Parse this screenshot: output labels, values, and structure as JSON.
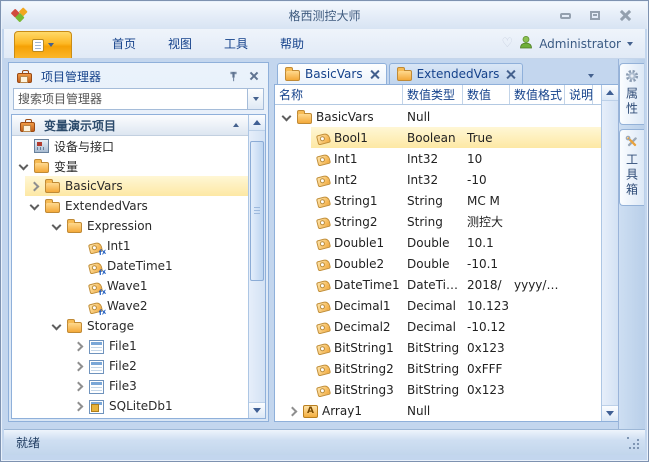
{
  "window": {
    "title": "格西测控大师"
  },
  "ribbon": {
    "tabs": {
      "home": "首页",
      "view": "视图",
      "tools": "工具",
      "help": "帮助"
    },
    "user": "Administrator"
  },
  "project_panel": {
    "title": "项目管理器",
    "search_placeholder": "搜索项目管理器",
    "root": "变量演示项目",
    "items": [
      {
        "label": "设备与接口"
      },
      {
        "label": "变量"
      },
      {
        "label": "BasicVars"
      },
      {
        "label": "ExtendedVars"
      },
      {
        "label": "Expression"
      },
      {
        "label": "Int1"
      },
      {
        "label": "DateTime1"
      },
      {
        "label": "Wave1"
      },
      {
        "label": "Wave2"
      },
      {
        "label": "Storage"
      },
      {
        "label": "File1"
      },
      {
        "label": "File2"
      },
      {
        "label": "File3"
      },
      {
        "label": "SQLiteDb1"
      }
    ]
  },
  "document": {
    "tabs": [
      {
        "label": "BasicVars"
      },
      {
        "label": "ExtendedVars"
      }
    ]
  },
  "grid": {
    "columns": [
      "名称",
      "数值类型",
      "数值",
      "数值格式",
      "说明"
    ],
    "rows": [
      {
        "name": "BasicVars",
        "type": "Null",
        "value": "",
        "format": "",
        "desc": ""
      },
      {
        "name": "Bool1",
        "type": "Boolean",
        "value": "True",
        "format": "",
        "desc": ""
      },
      {
        "name": "Int1",
        "type": "Int32",
        "value": "10",
        "format": "",
        "desc": ""
      },
      {
        "name": "Int2",
        "type": "Int32",
        "value": "-10",
        "format": "",
        "desc": ""
      },
      {
        "name": "String1",
        "type": "String",
        "value": "MC M",
        "format": "",
        "desc": ""
      },
      {
        "name": "String2",
        "type": "String",
        "value": "测控大",
        "format": "",
        "desc": ""
      },
      {
        "name": "Double1",
        "type": "Double",
        "value": "10.1",
        "format": "",
        "desc": ""
      },
      {
        "name": "Double2",
        "type": "Double",
        "value": "-10.1",
        "format": "",
        "desc": ""
      },
      {
        "name": "DateTime1",
        "type": "DateTi…",
        "value": "2018/",
        "format": "yyyy/…",
        "desc": ""
      },
      {
        "name": "Decimal1",
        "type": "Decimal",
        "value": "10.123",
        "format": "",
        "desc": ""
      },
      {
        "name": "Decimal2",
        "type": "Decimal",
        "value": "-10.12",
        "format": "",
        "desc": ""
      },
      {
        "name": "BitString1",
        "type": "BitString",
        "value": "0x123",
        "format": "",
        "desc": ""
      },
      {
        "name": "BitString2",
        "type": "BitString",
        "value": "0xFFF",
        "format": "",
        "desc": ""
      },
      {
        "name": "BitString3",
        "type": "BitString",
        "value": "0x123",
        "format": "",
        "desc": ""
      },
      {
        "name": "Array1",
        "type": "Null",
        "value": "",
        "format": "",
        "desc": ""
      }
    ]
  },
  "side_tabs": [
    {
      "label": "属性"
    },
    {
      "label": "工具箱"
    }
  ],
  "statusbar": {
    "text": "就绪"
  },
  "icons": {
    "app-logo-icon": "three-diamonds (red/orange/green)",
    "app-menu-icon": "document-list with caret",
    "favorite-icon": "♡",
    "user-avatar-icon": "green person bust",
    "project-manager-icon": "orange briefcase",
    "pin-icon": "pushpin",
    "gear-icon": "gear",
    "toolbox-icon": "crossed tools",
    "folder-icon": "orange folder",
    "tag-icon": "orange value tag",
    "tag-fx-icon": "orange tag with fx",
    "device-icon": "interface card",
    "table-icon": "file table",
    "database-icon": "sqlite table",
    "array-icon": "A box"
  },
  "colors": {
    "app_button_orange": "#f9a91a",
    "selection_highlight": "#fde8a4",
    "tab_text": "#15428b",
    "panel_border": "#8fb0da"
  }
}
